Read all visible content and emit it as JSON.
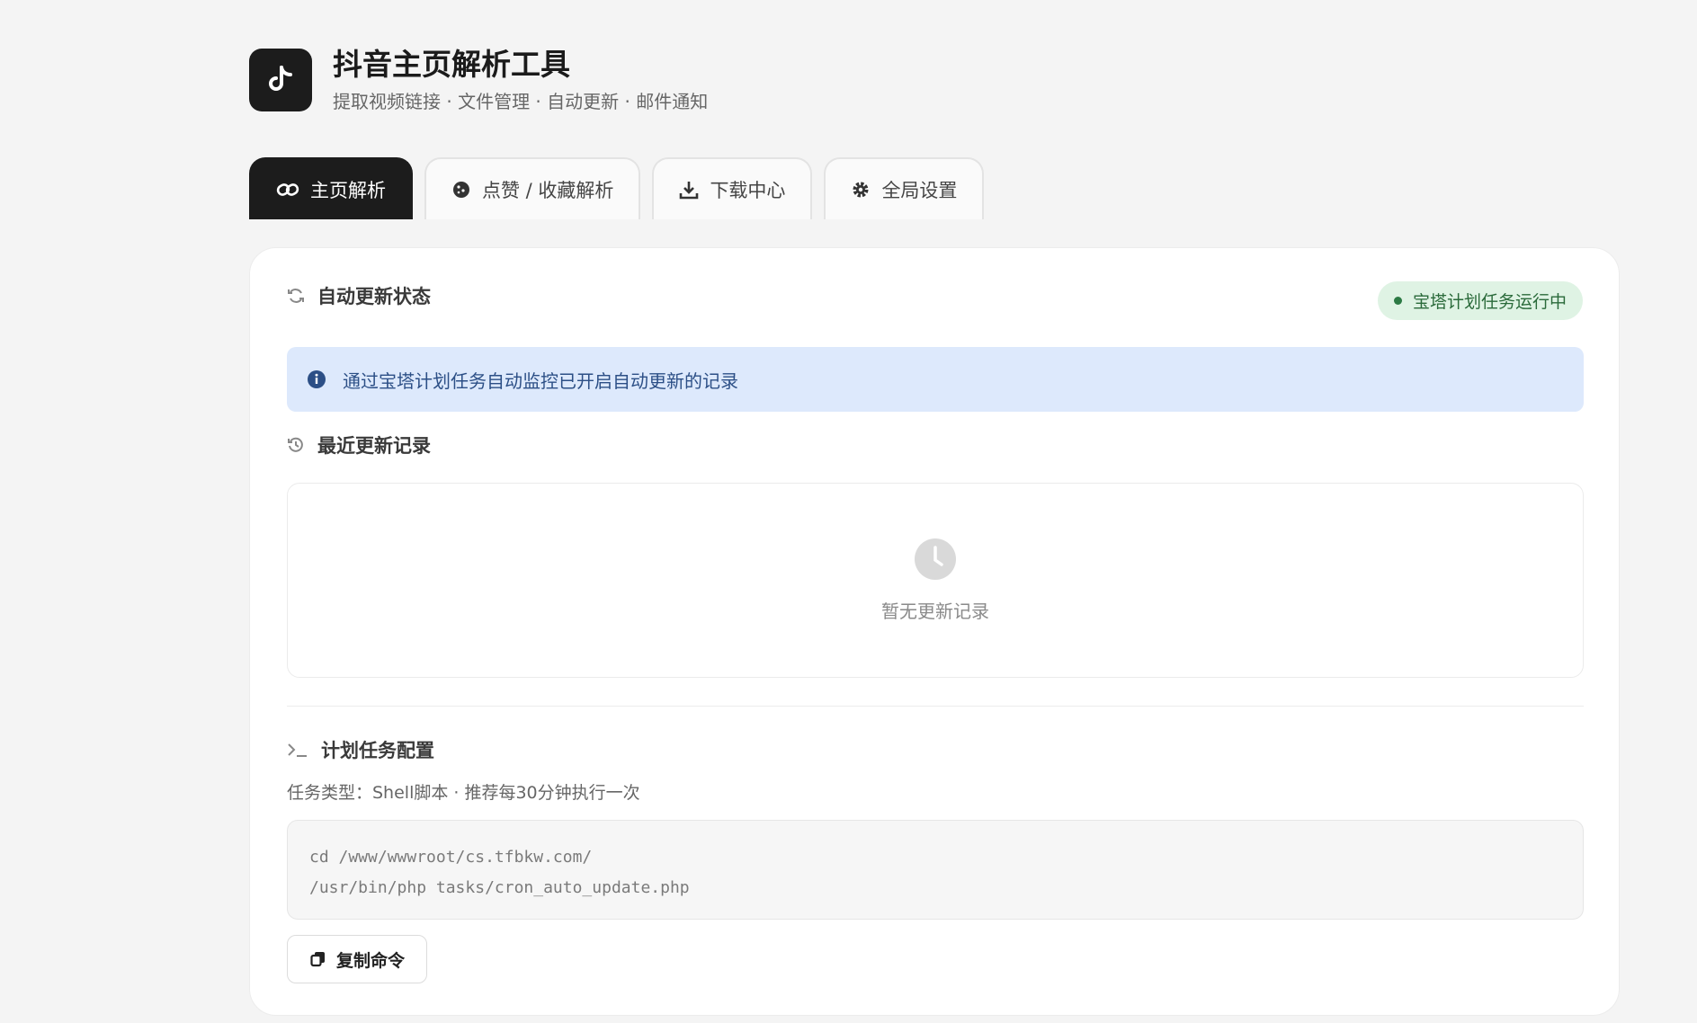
{
  "header": {
    "title": "抖音主页解析工具",
    "subtitle": "提取视频链接 · 文件管理 · 自动更新 · 邮件通知",
    "logo_icon": "tiktok-icon"
  },
  "tabs": [
    {
      "label": "主页解析",
      "icon": "link-icon",
      "active": true
    },
    {
      "label": "点赞 / 收藏解析",
      "icon": "cookie-icon",
      "active": false
    },
    {
      "label": "下载中心",
      "icon": "download-icon",
      "active": false
    },
    {
      "label": "全局设置",
      "icon": "gear-icon",
      "active": false
    }
  ],
  "auto_update": {
    "heading": "自动更新状态",
    "status_badge": "宝塔计划任务运行中",
    "info_text": "通过宝塔计划任务自动监控已开启自动更新的记录"
  },
  "recent": {
    "heading": "最近更新记录",
    "empty_text": "暂无更新记录"
  },
  "cron": {
    "heading": "计划任务配置",
    "task_info": "任务类型：Shell脚本 · 推荐每30分钟执行一次",
    "code_line1": "cd /www/wwwroot/cs.tfbkw.com/",
    "code_line2": "/usr/bin/php tasks/cron_auto_update.php",
    "copy_label": "复制命令"
  },
  "colors": {
    "accent_dark": "#1c1c1c",
    "status_green": "#2c7a44",
    "info_blue_bg": "#dde9fc"
  }
}
